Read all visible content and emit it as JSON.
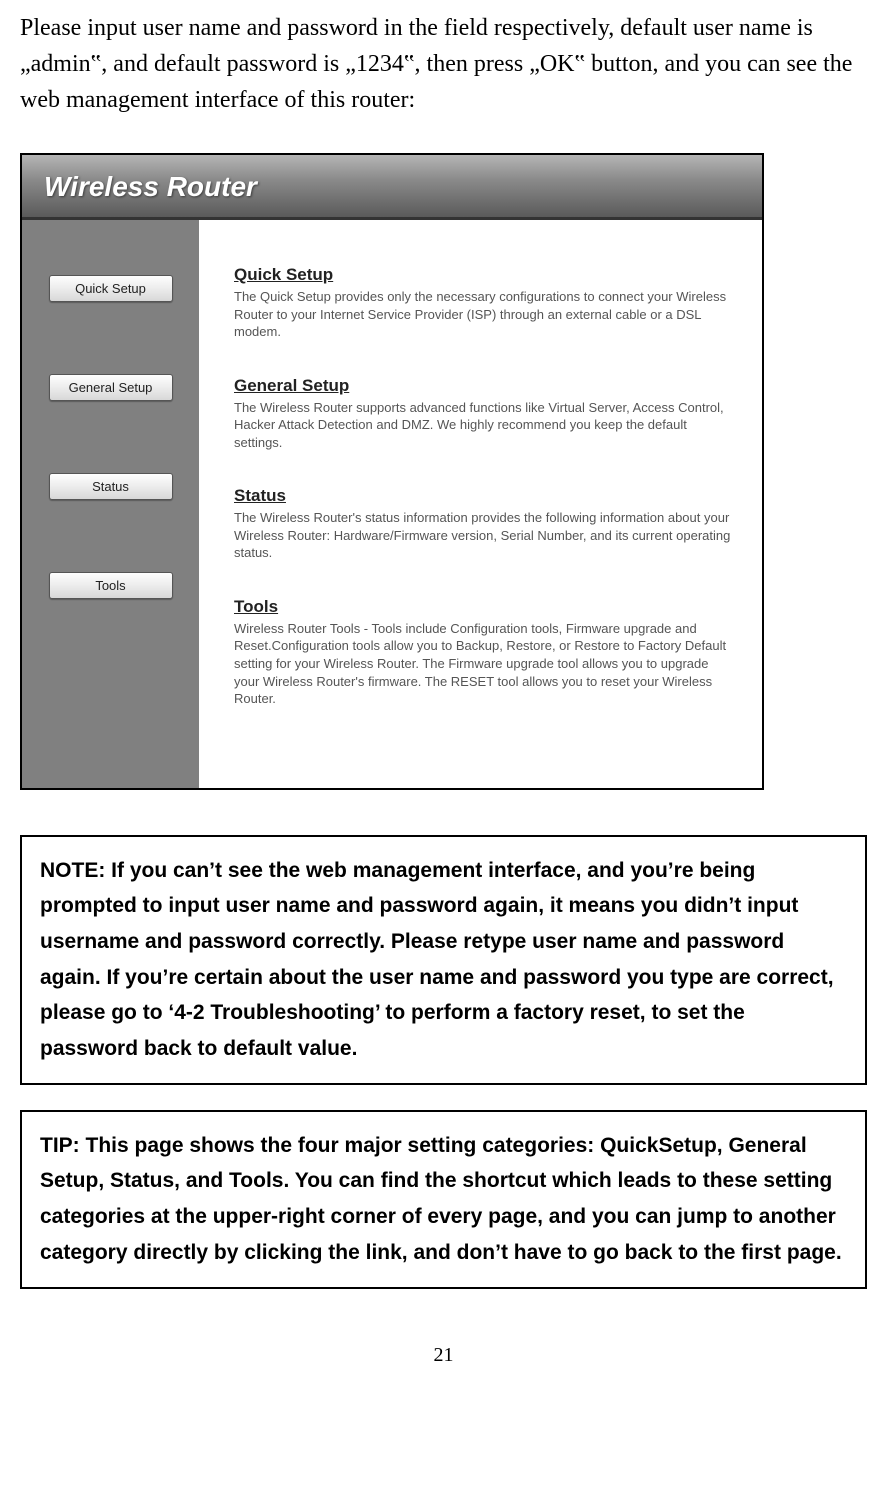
{
  "intro_text": "Please input user name and password in the field respectively, default user name is „admin‟, and default password is „1234‟, then press „OK‟ button, and you can see the web management interface of this router:",
  "router": {
    "header_title": "Wireless Router",
    "sidebar": {
      "button_quick_setup": "Quick Setup",
      "button_general_setup": "General Setup",
      "button_status": "Status",
      "button_tools": "Tools"
    },
    "sections": {
      "quick_setup": {
        "title": "Quick Setup",
        "desc": "The Quick Setup provides only the necessary configurations to connect your Wireless Router to your Internet Service Provider (ISP) through an external cable or a DSL modem."
      },
      "general_setup": {
        "title": "General Setup",
        "desc": "The Wireless Router supports advanced functions like Virtual Server, Access Control, Hacker Attack Detection and DMZ. We highly recommend you keep the default settings."
      },
      "status": {
        "title": "Status",
        "desc": "The Wireless Router's status information provides the following information about your Wireless Router: Hardware/Firmware version, Serial Number, and its current operating status."
      },
      "tools": {
        "title": "Tools",
        "desc": "Wireless Router Tools - Tools include Configuration tools, Firmware upgrade and Reset.Configuration tools allow you to Backup, Restore, or Restore to Factory Default setting for your Wireless Router. The Firmware upgrade tool allows you to upgrade your Wireless Router's firmware. The RESET tool allows you to reset your Wireless Router."
      }
    }
  },
  "note_box": "NOTE: If you can’t see the web management interface, and you’re being prompted to input user name and password again, it means you didn’t input username and password correctly. Please retype user name and password again. If you’re certain about the user name and password you type are correct, please go to ‘4-2 Troubleshooting’ to perform a factory reset, to set the password back to default value.",
  "tip_box": "TIP: This page shows the four major setting categories: QuickSetup, General Setup, Status, and Tools. You can find the shortcut which leads to these setting categories at the upper-right corner of every page, and you can jump to another category directly by clicking the link, and don’t have to go back to the first page.",
  "page_number": "21"
}
